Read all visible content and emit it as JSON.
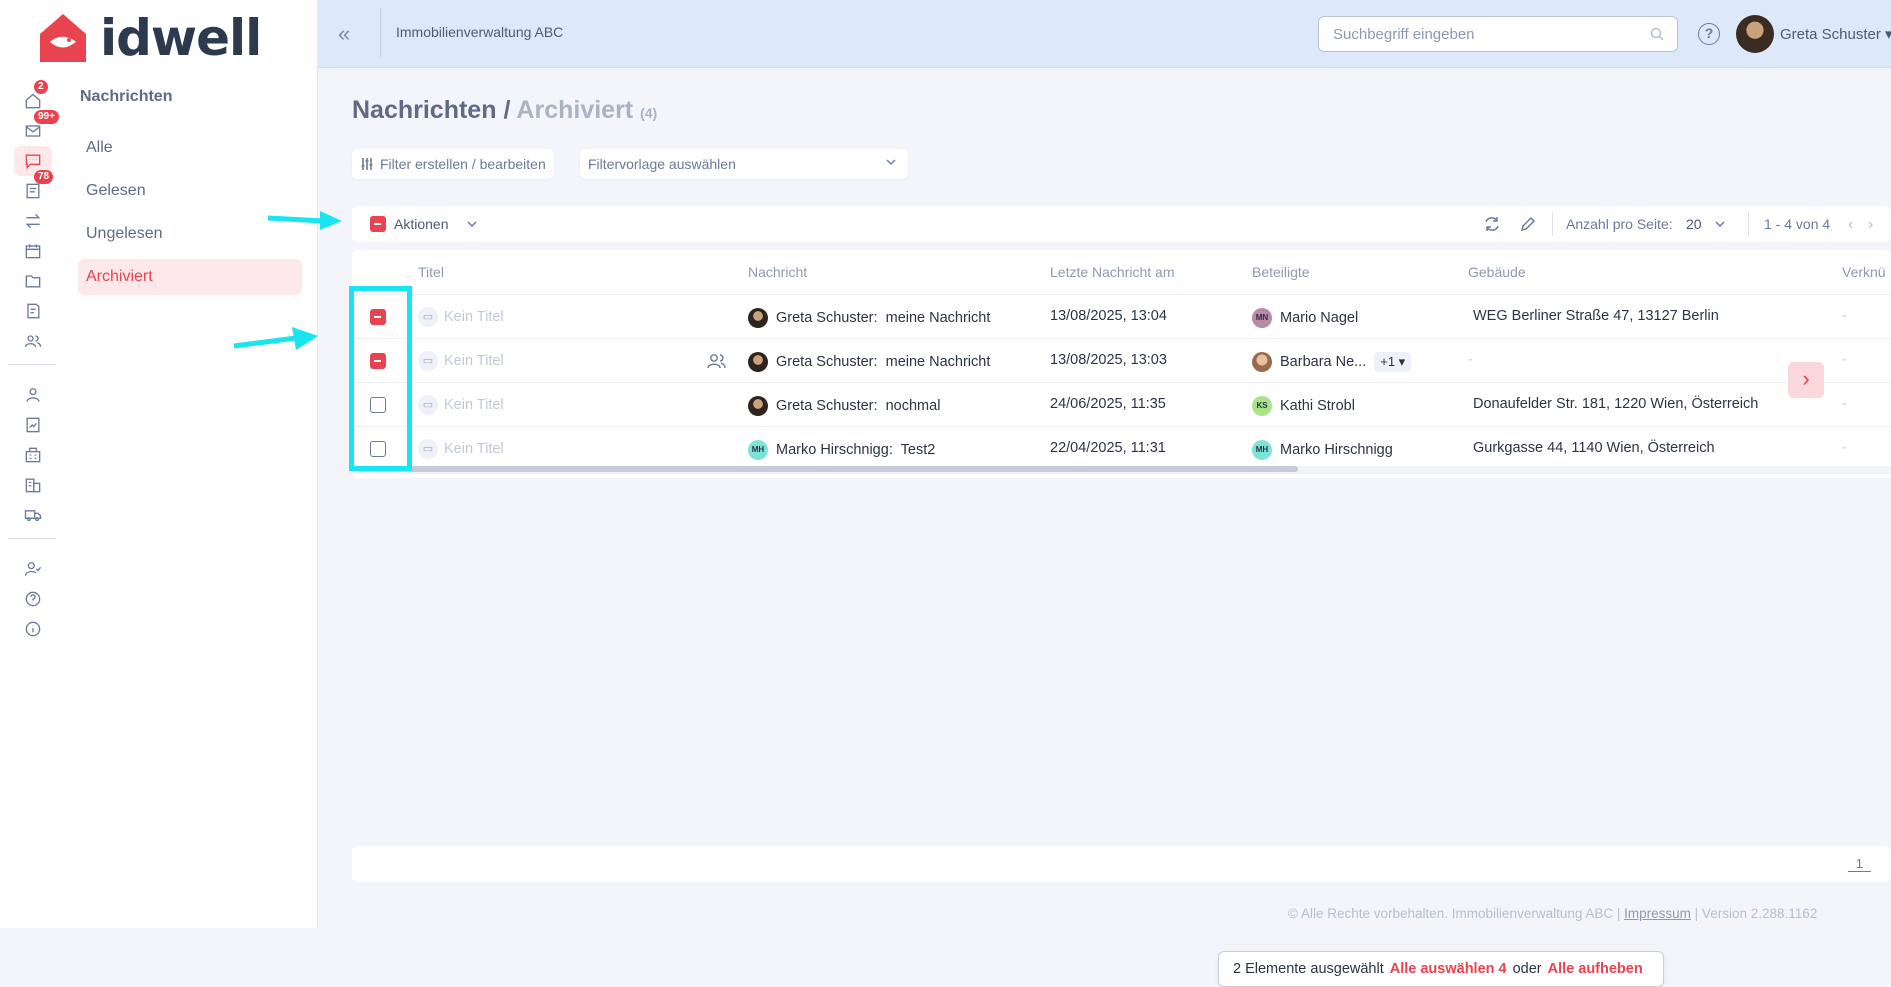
{
  "app": {
    "logo_text": "idwell",
    "brand_color": "#e8434f"
  },
  "rail": {
    "badges": {
      "home": "2",
      "mail": "99+",
      "tasks": "78"
    },
    "icons": [
      "home-icon",
      "mail-icon",
      "chat-icon",
      "tasks-icon",
      "transfer-icon",
      "calendar-icon",
      "folder-icon",
      "invoice-icon",
      "people-icon",
      "person-icon",
      "contract-icon",
      "building-icon",
      "buildings-icon",
      "truck-icon",
      "user-check-icon",
      "help-icon",
      "info-icon"
    ]
  },
  "subnav": {
    "title": "Nachrichten",
    "items": [
      {
        "label": "Alle"
      },
      {
        "label": "Gelesen"
      },
      {
        "label": "Ungelesen"
      },
      {
        "label": "Archiviert",
        "active": true
      }
    ]
  },
  "header": {
    "org": "Immobilienverwaltung ABC",
    "search_placeholder": "Suchbegriff eingeben",
    "help": "?",
    "user": "Greta Schuster"
  },
  "page": {
    "title": "Nachrichten",
    "slash": "/",
    "subtitle": "Archiviert",
    "count": "(4)"
  },
  "filters": {
    "edit_label": "Filter erstellen / bearbeiten",
    "preset_placeholder": "Filtervorlage auswählen"
  },
  "toolbar": {
    "actions_label": "Aktionen",
    "per_page_label": "Anzahl pro Seite:",
    "per_page_value": "20",
    "range": "1 - 4 von 4",
    "prev": "‹",
    "next": "›"
  },
  "table": {
    "columns": [
      "Titel",
      "Nachricht",
      "Letzte Nachricht am",
      "Beteiligte",
      "Gebäude",
      "Verknü"
    ],
    "rows": [
      {
        "checked": true,
        "title": "Kein Titel",
        "sender": "Greta Schuster:",
        "message": "meine Nachricht",
        "date": "13/08/2025, 13:04",
        "participant_initials": "MN",
        "participant": "Mario Nagel",
        "extra": "",
        "building": "WEG Berliner Straße 47, 13127 Berlin",
        "link": "-"
      },
      {
        "checked": true,
        "title": "Kein Titel",
        "sender": "Greta Schuster:",
        "message": "meine Nachricht",
        "date": "13/08/2025, 13:03",
        "participant_initials": "",
        "participant": "Barbara Ne...",
        "extra": "+1 ▾",
        "building": "-",
        "link": "-"
      },
      {
        "checked": false,
        "title": "Kein Titel",
        "sender": "Greta Schuster:",
        "message": "nochmal",
        "date": "24/06/2025, 11:35",
        "participant_initials": "KS",
        "participant": "Kathi Strobl",
        "extra": "",
        "building": "Donaufelder Str. 181, 1220 Wien, Österreich",
        "link": "-"
      },
      {
        "checked": false,
        "title": "Kein Titel",
        "sender_initials": "MH",
        "sender": "Marko Hirschnigg:",
        "message": "Test2",
        "date": "22/04/2025, 11:31",
        "participant_initials": "MH",
        "participant": "Marko Hirschnigg",
        "extra": "",
        "building": "Gurkgasse 44, 1140 Wien, Österreich",
        "link": "-"
      }
    ]
  },
  "pagination": {
    "page": "1"
  },
  "footer": {
    "copyright": "© Alle Rechte vorbehalten. Immobilienverwaltung ABC |",
    "impressum": "Impressum",
    "version": "| Version 2.288.1162"
  },
  "selection_bar": {
    "text": "2 Elemente ausgewählt",
    "select_all": "Alle auswählen 4",
    "or": "oder",
    "deselect": "Alle aufheben"
  },
  "annotation_color": "#19e5f0"
}
